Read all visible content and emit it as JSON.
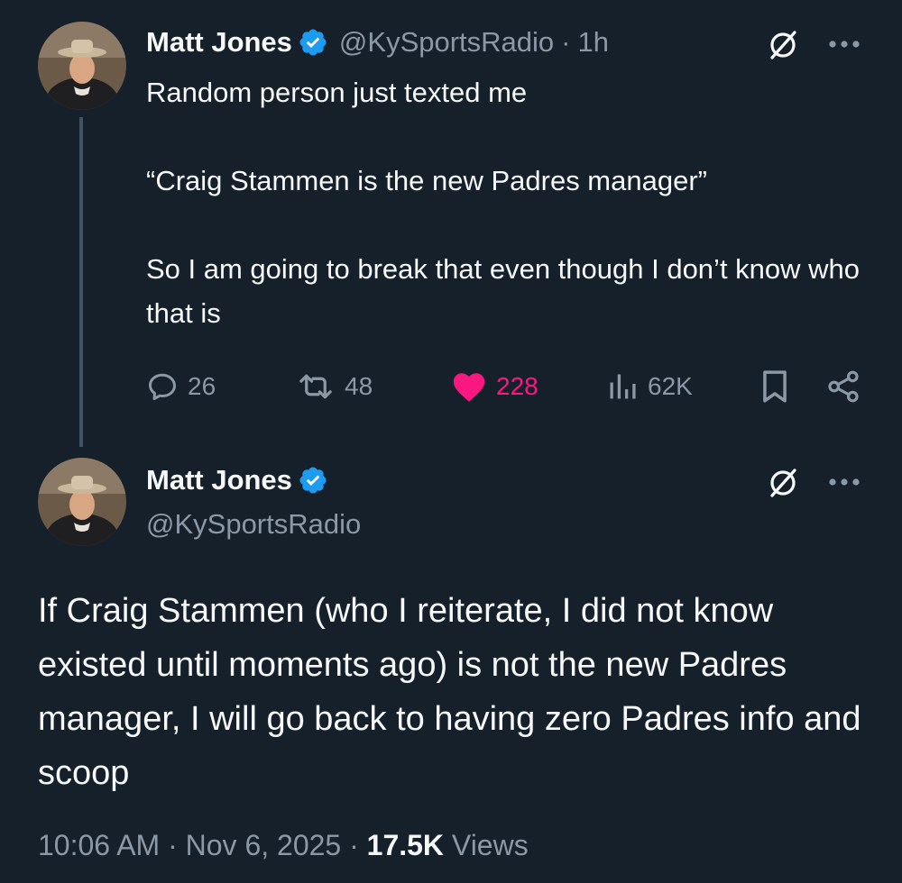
{
  "parent_tweet": {
    "author_name": "Matt Jones",
    "handle": "@KySportsRadio",
    "separator": "·",
    "time_ago": "1h",
    "text_line_1": "Random person just texted me",
    "text_line_2": "“Craig Stammen is the new Padres manager”",
    "text_line_3": "So I am going to break that even though I don’t know who that is",
    "actions": {
      "replies": "26",
      "reposts": "48",
      "likes": "228",
      "views": "62K"
    }
  },
  "main_tweet": {
    "author_name": "Matt Jones",
    "handle": "@KySportsRadio",
    "text": "If Craig Stammen (who I reiterate, I did not know existed until moments ago) is not the new Padres manager, I will go back to having zero Padres info and scoop",
    "time": "10:06 AM",
    "separator": "·",
    "date": "Nov 6, 2025",
    "views_count": "17.5K",
    "views_label": "Views"
  },
  "colors": {
    "background": "#15202b",
    "text": "#f7f9f9",
    "secondary": "#8b98a5",
    "verified": "#1d9bf0",
    "like": "#f91880",
    "thread_line": "#425364"
  },
  "icons": {
    "verified": "verified-badge-icon",
    "grok": "grok-icon",
    "more": "more-icon",
    "reply": "reply-icon",
    "repost": "repost-icon",
    "like": "heart-icon",
    "views": "views-icon",
    "bookmark": "bookmark-icon",
    "share": "share-icon"
  }
}
